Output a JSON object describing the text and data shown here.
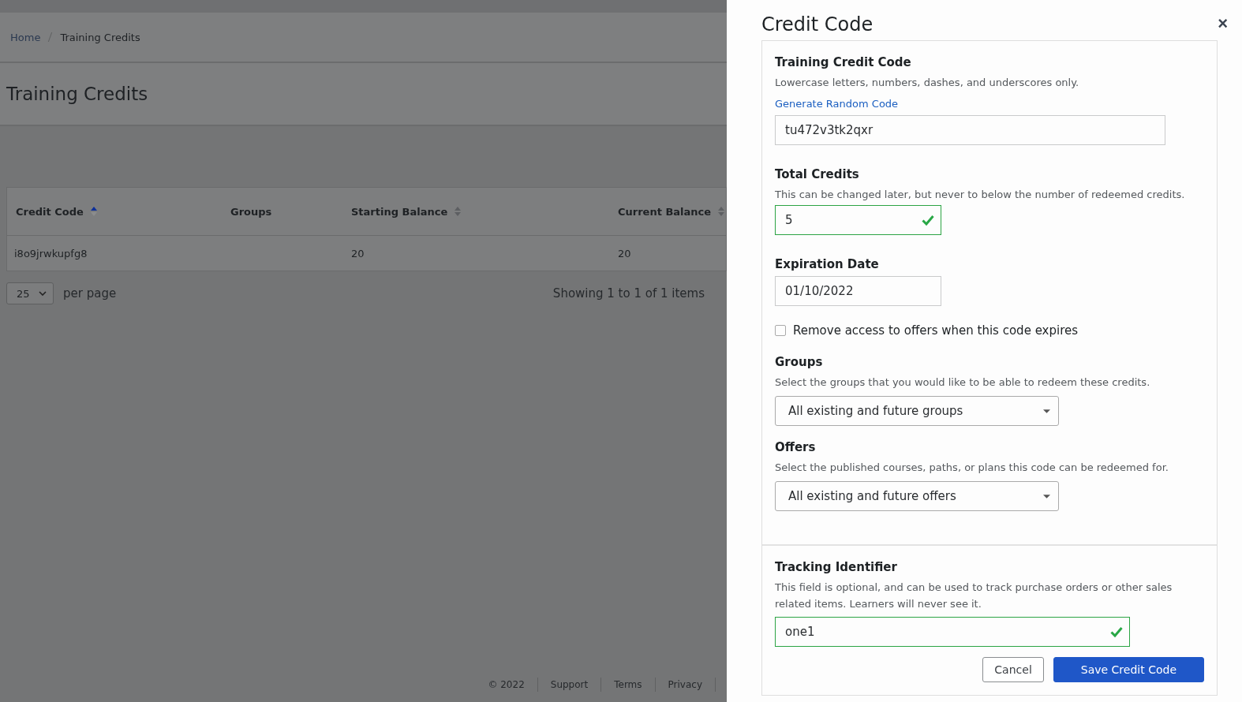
{
  "breadcrumb": [
    {
      "label": "Home",
      "current": false
    },
    {
      "label": "Training Credits",
      "current": true
    }
  ],
  "page_title": "Training Credits",
  "table": {
    "columns": [
      {
        "label": "Credit Code",
        "sortable": true,
        "sorted": true
      },
      {
        "label": "Groups",
        "sortable": false
      },
      {
        "label": "Starting Balance",
        "sortable": true,
        "sorted": false
      },
      {
        "label": "Current Balance",
        "sortable": true,
        "sorted": false
      }
    ],
    "rows": [
      {
        "cells": [
          "i8o9jrwkupfg8",
          "",
          "20",
          "20"
        ]
      }
    ]
  },
  "pagination": {
    "per_page": "25",
    "per_page_label": "per page",
    "summary": "Showing 1 to 1 of 1 items"
  },
  "footer": [
    "© 2022",
    "Support",
    "Terms",
    "Privacy"
  ],
  "drawer": {
    "title": "Credit Code",
    "close": "×",
    "sections": [
      {
        "kind": "wide_text",
        "label": "Training Credit Code",
        "help": "Lowercase letters, numbers, dashes, and underscores only.",
        "link": "Generate Random Code",
        "value": "tu472v3tk2qxr",
        "valid": false
      },
      {
        "kind": "text",
        "label": "Total Credits",
        "help": "This can be changed later, but never to below the number of redeemed credits.",
        "value": "5",
        "valid": true
      },
      {
        "kind": "text",
        "label": "Expiration Date",
        "value": "01/10/2022",
        "valid": false
      },
      {
        "kind": "checkbox",
        "label": "Remove access to offers when this code expires",
        "checked": false
      },
      {
        "kind": "select",
        "label": "Groups",
        "help": "Select the groups that you would like to be able to redeem these credits.",
        "value": "All existing and future groups"
      },
      {
        "kind": "select",
        "label": "Offers",
        "help": "Select the published courses, paths, or plans this code can be redeemed for.",
        "value": "All existing and future offers"
      }
    ],
    "tracking": {
      "label": "Tracking Identifier",
      "help": "This field is optional, and can be used to track purchase orders or other sales related items. Learners will never see it.",
      "value": "one1",
      "valid": true
    },
    "buttons": [
      {
        "label": "Cancel",
        "primary": false
      },
      {
        "label": "Save Credit Code",
        "primary": true
      }
    ]
  }
}
